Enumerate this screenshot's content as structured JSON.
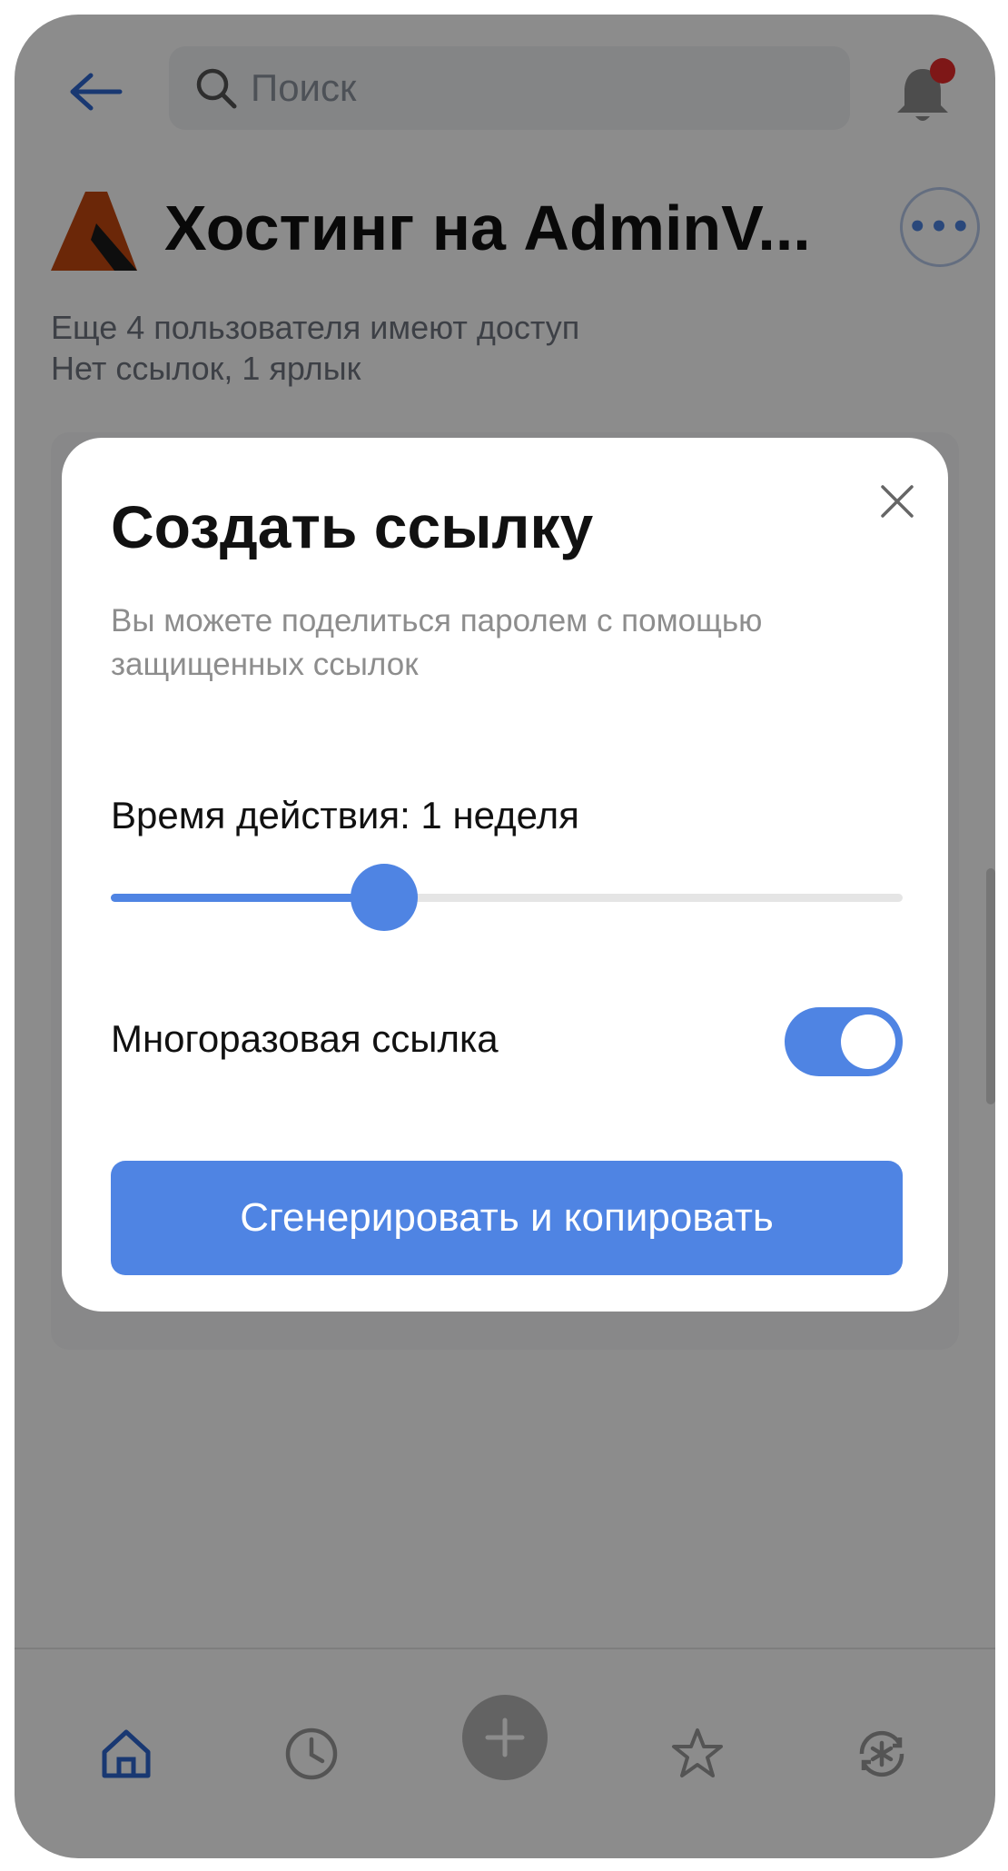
{
  "topbar": {
    "search_placeholder": "Поиск",
    "notification_badge": true
  },
  "item": {
    "title": "Хостинг на AdminV...",
    "shared_with": "Еще 4 пользователя имеют доступ",
    "links_info": "Нет ссылок, 1 ярлык"
  },
  "modal": {
    "title": "Создать ссылку",
    "description": "Вы можете поделиться паролем с помощью защищенных ссылок",
    "duration_label": "Время действия: 1 неделя",
    "duration_slider_fraction": 0.345,
    "reusable_label": "Многоразовая ссылка",
    "reusable_enabled": true,
    "generate_button": "Сгенерировать и копировать"
  },
  "bottom_nav": {
    "items": [
      {
        "icon": "home-icon",
        "active": true
      },
      {
        "icon": "clock-icon",
        "active": false
      },
      {
        "icon": "plus-icon",
        "active": false
      },
      {
        "icon": "star-icon",
        "active": false
      },
      {
        "icon": "asterisk-refresh-icon",
        "active": false
      }
    ]
  },
  "colors": {
    "accent": "#4f84e3",
    "badge": "#e52a2a",
    "logo_orange": "#c4470f",
    "logo_dark": "#1a1a1a"
  }
}
